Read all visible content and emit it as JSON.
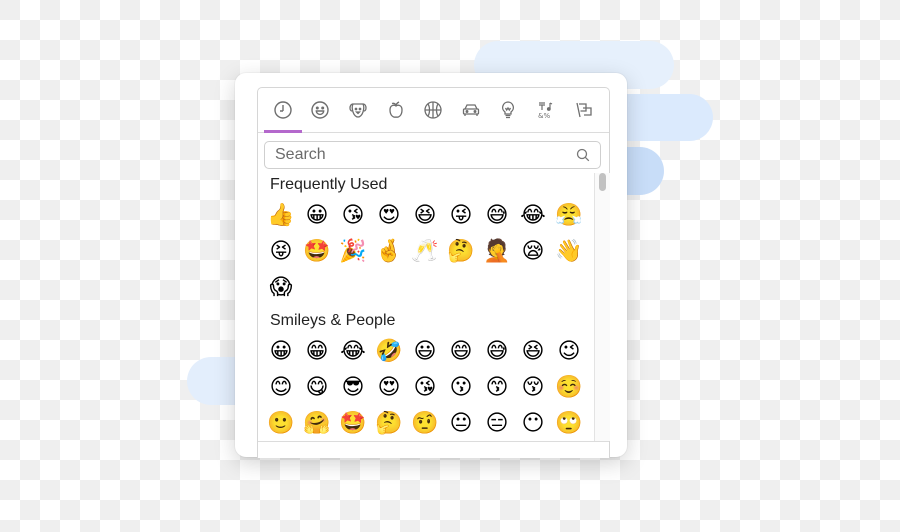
{
  "tabs": [
    {
      "id": "recent",
      "icon": "clock-icon",
      "active": true
    },
    {
      "id": "smileys",
      "icon": "smiley-icon",
      "active": false
    },
    {
      "id": "animals",
      "icon": "dog-icon",
      "active": false
    },
    {
      "id": "food",
      "icon": "apple-icon",
      "active": false
    },
    {
      "id": "activity",
      "icon": "basketball-icon",
      "active": false
    },
    {
      "id": "travel",
      "icon": "car-icon",
      "active": false
    },
    {
      "id": "objects",
      "icon": "lightbulb-icon",
      "active": false
    },
    {
      "id": "symbols",
      "icon": "symbols-icon",
      "active": false
    },
    {
      "id": "flags",
      "icon": "flag-icon",
      "active": false
    }
  ],
  "search": {
    "placeholder": "Search",
    "value": ""
  },
  "colors": {
    "accent": "#b468cc",
    "border": "#d6d6d6"
  },
  "sections": [
    {
      "title": "Frequently Used",
      "emojis": [
        "👍",
        "😀",
        "😘",
        "😍",
        "😆",
        "😜",
        "😅",
        "😂",
        "😤",
        "😝",
        "🤩",
        "🎉",
        "🤞",
        "🥂",
        "🤔",
        "🤦",
        "😪",
        "👋",
        "😱"
      ]
    },
    {
      "title": "Smileys & People",
      "emojis": [
        "😀",
        "😁",
        "😂",
        "🤣",
        "😃",
        "😄",
        "😅",
        "😆",
        "😉",
        "😊",
        "😋",
        "😎",
        "😍",
        "😘",
        "😗",
        "😙",
        "😚",
        "☺️",
        "🙂",
        "🤗",
        "🤩",
        "🤔",
        "🤨",
        "😐",
        "😑",
        "😶",
        "🙄"
      ]
    }
  ]
}
